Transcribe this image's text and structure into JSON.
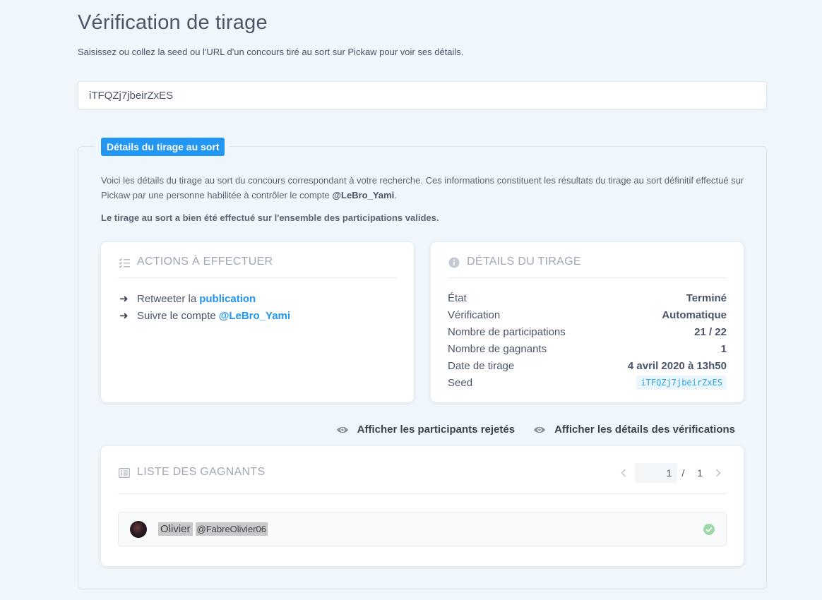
{
  "page": {
    "title": "Vérification de tirage",
    "subtitle": "Saisissez ou collez la seed ou l'URL d'un concours tiré au sort sur Pickaw pour voir ses détails."
  },
  "search": {
    "value": "iTFQZj7jbeirZxES",
    "placeholder": ""
  },
  "details": {
    "badge": "Détails du tirage au sort",
    "intro_text": "Voici les détails du tirage au sort du concours correspondant à votre recherche. Ces informations constituent les résultats du tirage au sort définitif effectué sur Pickaw par une personne habilitée à contrôler le compte ",
    "intro_account": "@LeBro_Yami",
    "intro_end": ".",
    "valid_text": "Le tirage au sort a bien été effectué sur l'ensemble des participations valides."
  },
  "actions_card": {
    "title": "ACTIONS À EFFECTUER",
    "icon": "checklist-icon",
    "items": [
      {
        "prefix": "Retweeter la",
        "link": "publication"
      },
      {
        "prefix": "Suivre le compte",
        "link": "@LeBro_Yami"
      }
    ]
  },
  "draw_card": {
    "title": "DÉTAILS DU TIRAGE",
    "icon": "info-icon",
    "rows": [
      {
        "label": "État",
        "value": "Terminé"
      },
      {
        "label": "Vérification",
        "value": "Automatique"
      },
      {
        "label": "Nombre de participations",
        "value": "21 / 22"
      },
      {
        "label": "Nombre de gagnants",
        "value": "1"
      },
      {
        "label": "Date de tirage",
        "value": "4 avril 2020 à 13h50"
      },
      {
        "label": "Seed",
        "value": "iTFQZj7jbeirZxES"
      }
    ]
  },
  "toggles": {
    "rejected": "Afficher les participants rejetés",
    "verifications": "Afficher les détails des vérifications"
  },
  "winners_card": {
    "title": "LISTE DES GAGNANTS",
    "icon": "list-icon",
    "pagination": {
      "current": "1",
      "separator": "/",
      "total": "1"
    },
    "winners": [
      {
        "name": "Olivier",
        "handle": "@FabreOlivier06",
        "verified": true
      }
    ]
  },
  "colors": {
    "accent": "#2196f3",
    "background": "#eff6fc",
    "check": "#9fd8a8"
  }
}
